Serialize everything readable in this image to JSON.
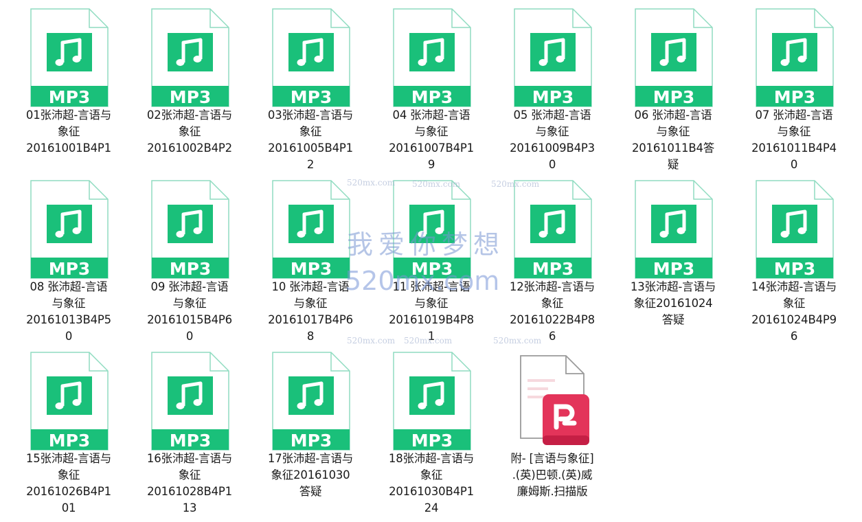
{
  "files": [
    {
      "name": "01张沛超-言语与象征20161001B4P1",
      "label": "01张沛超-言语与\n象征\n20161001B4P1",
      "type": "MP3"
    },
    {
      "name": "02张沛超-言语与象征20161002B4P2",
      "label": "02张沛超-言语与\n象征\n20161002B4P2",
      "type": "MP3"
    },
    {
      "name": "03张沛超-言语与象征20161005B4P12",
      "label": "03张沛超-言语与\n象征\n20161005B4P1\n2",
      "type": "MP3"
    },
    {
      "name": "04 张沛超-言语与象征20161007B4P19",
      "label": "04 张沛超-言语\n与象征\n20161007B4P1\n9",
      "type": "MP3"
    },
    {
      "name": "05 张沛超-言语与象征20161009B4P30",
      "label": "05 张沛超-言语\n与象征\n20161009B4P3\n0",
      "type": "MP3"
    },
    {
      "name": "06 张沛超-言语与象征20161011B4答疑",
      "label": "06 张沛超-言语\n与象征\n20161011B4答\n疑",
      "type": "MP3"
    },
    {
      "name": "07 张沛超-言语与象征20161011B4P40",
      "label": "07 张沛超-言语\n与象征\n20161011B4P4\n0",
      "type": "MP3"
    },
    {
      "name": "08 张沛超-言语与象征20161013B4P50",
      "label": "08 张沛超-言语\n与象征\n20161013B4P5\n0",
      "type": "MP3"
    },
    {
      "name": "09 张沛超-言语与象征20161015B4P60",
      "label": "09 张沛超-言语\n与象征\n20161015B4P6\n0",
      "type": "MP3"
    },
    {
      "name": "10 张沛超-言语与象征20161017B4P68",
      "label": "10 张沛超-言语\n与象征\n20161017B4P6\n8",
      "type": "MP3"
    },
    {
      "name": "11 张沛超-言语与象征20161019B4P81",
      "label": "11 张沛超-言语\n与象征\n20161019B4P8\n1",
      "type": "MP3"
    },
    {
      "name": "12张沛超-言语与象征20161022B4P86",
      "label": "12张沛超-言语与\n象征\n20161022B4P8\n6",
      "type": "MP3"
    },
    {
      "name": "13张沛超-言语与象征20161024答疑",
      "label": "13张沛超-言语与\n象征20161024\n答疑",
      "type": "MP3"
    },
    {
      "name": "14张沛超-言语与象征20161024B4P96",
      "label": "14张沛超-言语与\n象征\n20161024B4P9\n6",
      "type": "MP3"
    },
    {
      "name": "15张沛超-言语与象征20161026B4P101",
      "label": "15张沛超-言语与\n象征\n20161026B4P1\n01",
      "type": "MP3"
    },
    {
      "name": "16张沛超-言语与象征20161028B4P113",
      "label": "16张沛超-言语与\n象征\n20161028B4P1\n13",
      "type": "MP3"
    },
    {
      "name": "17张沛超-言语与象征20161030答疑",
      "label": "17张沛超-言语与\n象征20161030\n答疑",
      "type": "MP3"
    },
    {
      "name": "18张沛超-言语与象征20161030B4P124",
      "label": "18张沛超-言语与\n象征\n20161030B4P1\n24",
      "type": "MP3"
    },
    {
      "name": "附- [言语与象征].(英)巴顿.(英)威廉姆斯.扫描版",
      "label": "附- [言语与象征]\n.(英)巴顿.(英)威\n廉姆斯.扫描版",
      "type": "PDF"
    }
  ],
  "icon": {
    "mp3_badge": "MP3",
    "mp3_icon_name": "music-note-icon",
    "pdf_icon_name": "pdf-document-icon"
  },
  "watermark": {
    "text": "我爱你梦想",
    "url": "520mx.com",
    "small": "520mx.com"
  },
  "colors": {
    "mp3_green": "#1ac07a",
    "doc_outline": "#8fdcc0",
    "pdf_red": "#e3345a"
  }
}
